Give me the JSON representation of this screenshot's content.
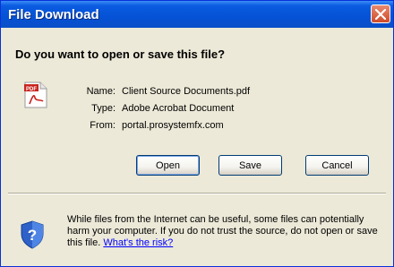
{
  "dialog": {
    "title": "File Download",
    "question": "Do you want to open or save this file?"
  },
  "file": {
    "name_label": "Name:",
    "name": "Client Source Documents.pdf",
    "type_label": "Type:",
    "type": "Adobe Acrobat Document",
    "from_label": "From:",
    "from": "portal.prosystemfx.com",
    "icon": "pdf-file-icon"
  },
  "buttons": {
    "open": "Open",
    "save": "Save",
    "cancel": "Cancel"
  },
  "warning": {
    "text": "While files from the Internet can be useful, some files can potentially harm your computer. If you do not trust the source, do not open or save this file. ",
    "link": "What's the risk?",
    "icon": "shield-question-icon"
  },
  "colors": {
    "titlebar": "#0552d6",
    "dialog_bg": "#ece9d8",
    "link": "#0000ff"
  }
}
